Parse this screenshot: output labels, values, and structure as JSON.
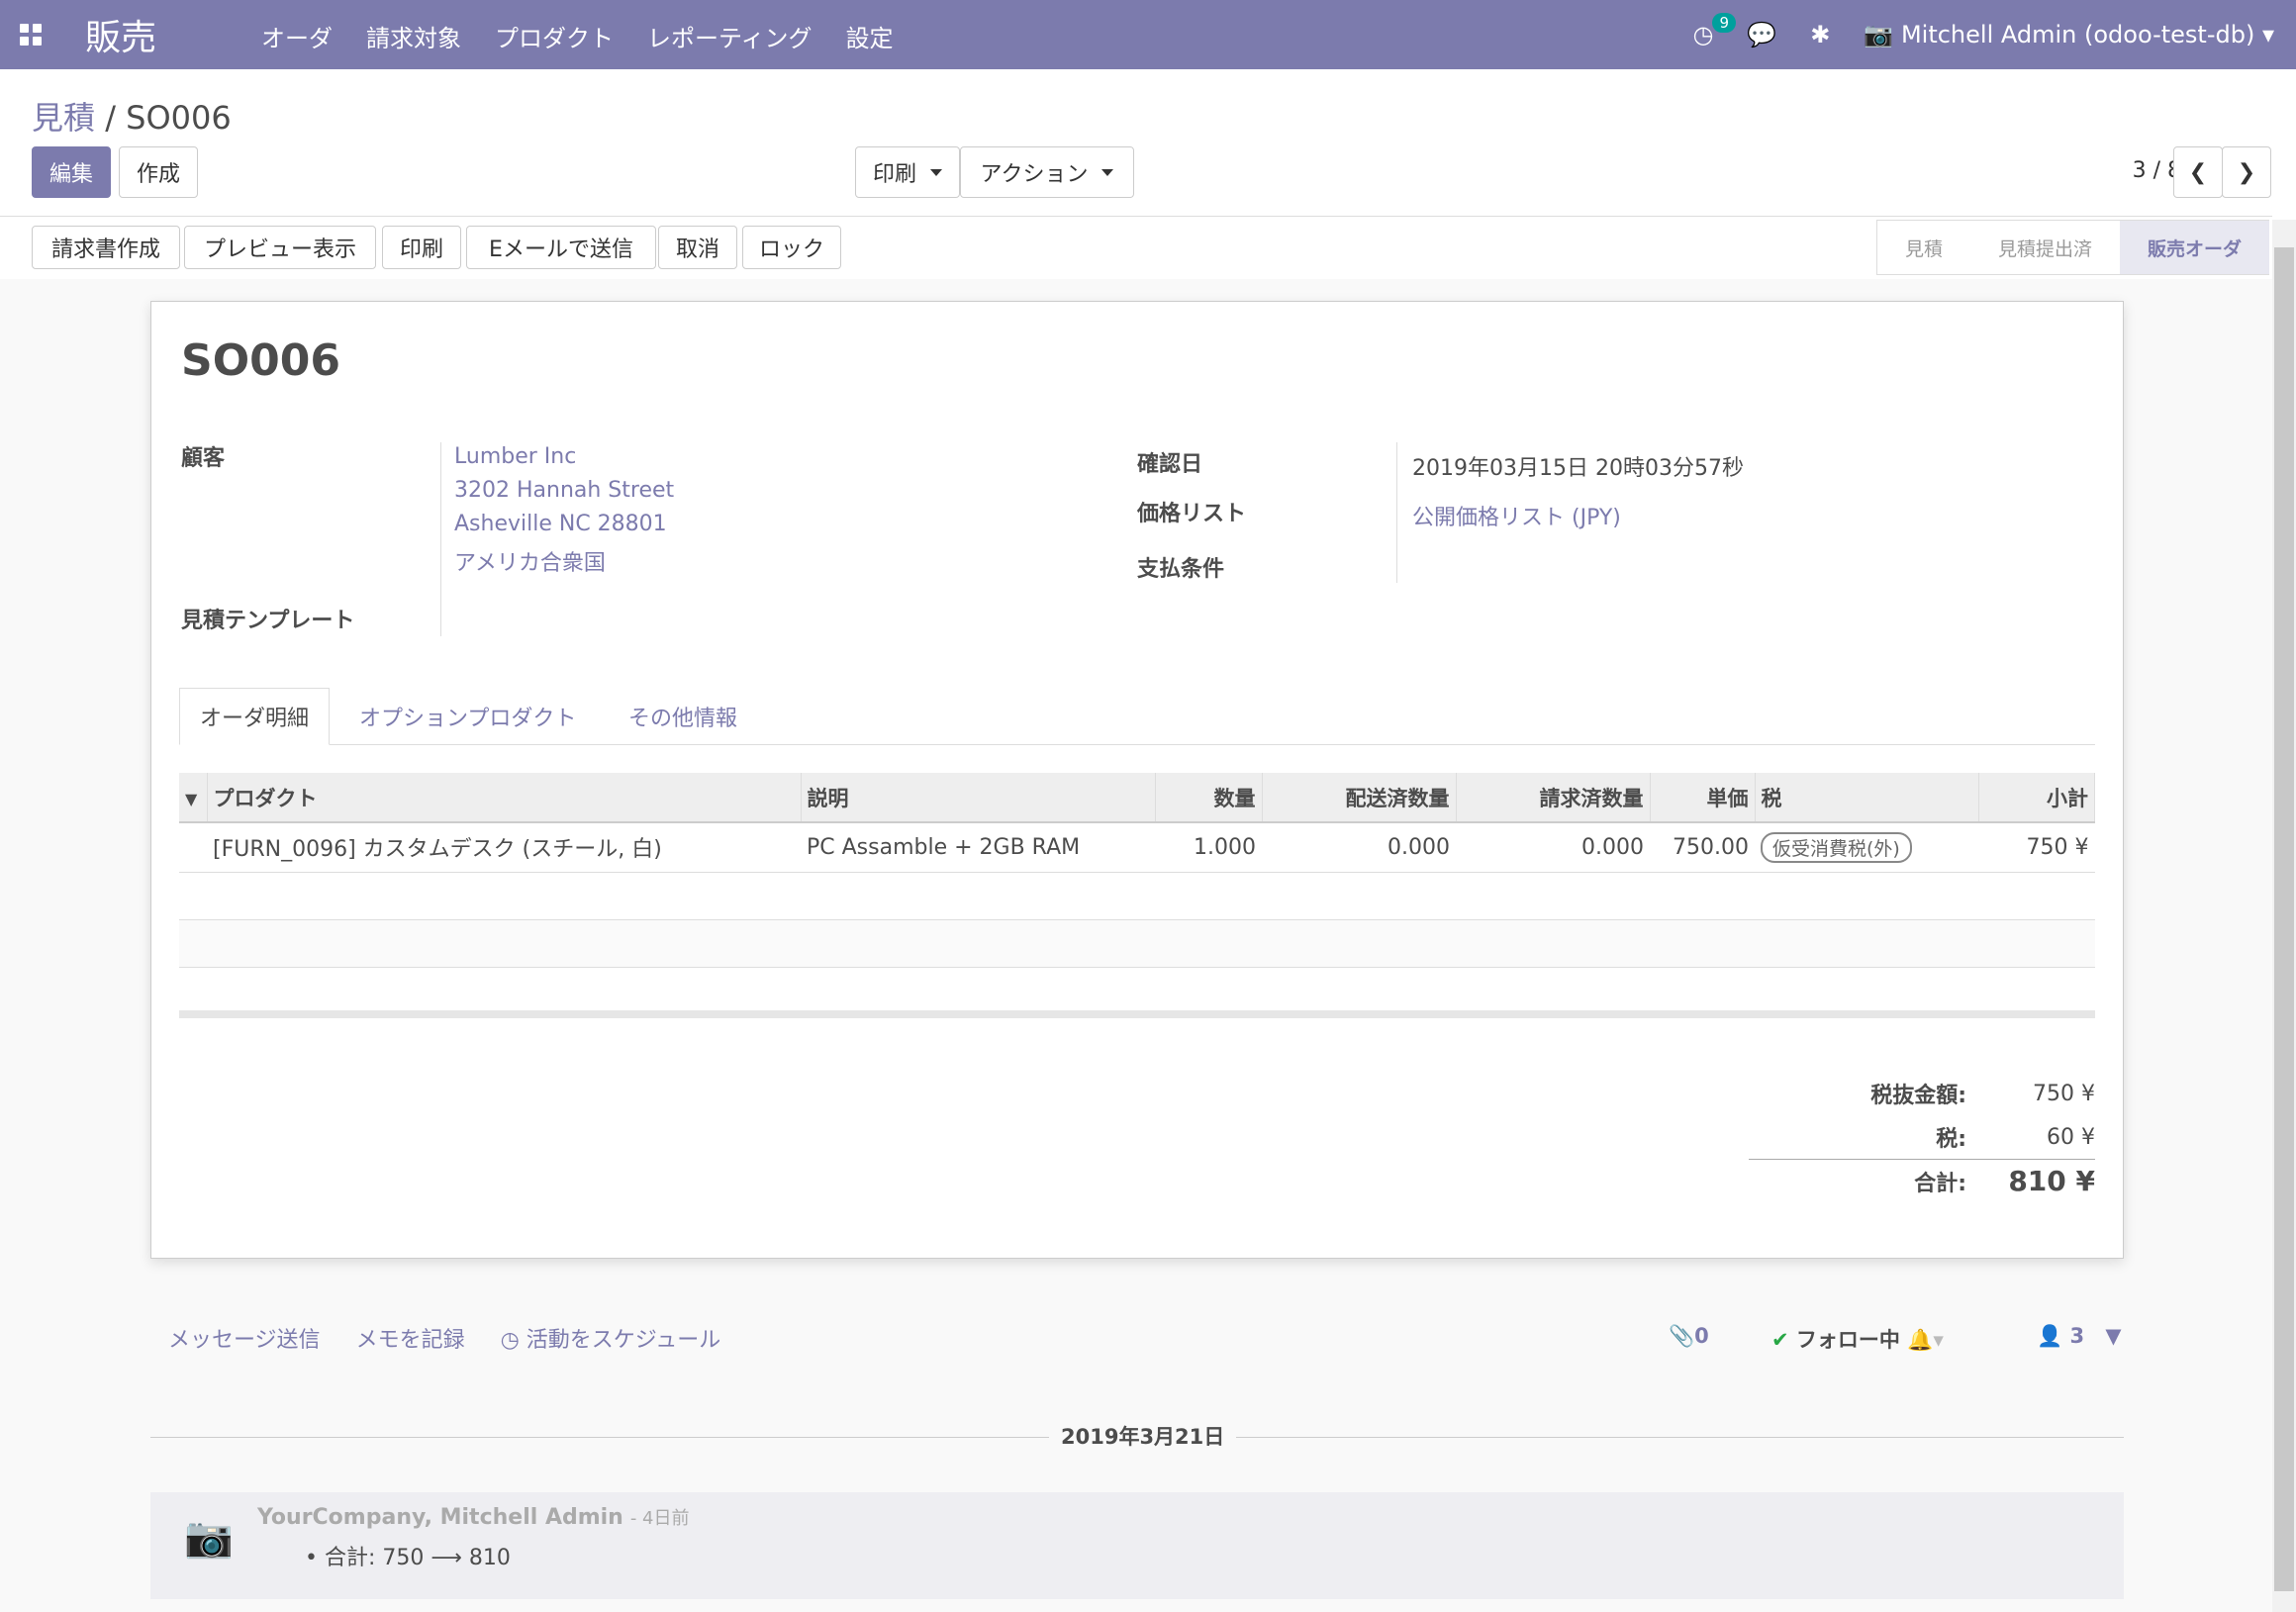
{
  "topbar": {
    "app_name": "販売",
    "menu": [
      "オーダ",
      "請求対象",
      "プロダクト",
      "レポーティング",
      "設定"
    ],
    "activity_count": "9",
    "user": "Mitchell Admin (odoo-test-db)"
  },
  "breadcrumb": {
    "parent": "見積",
    "current": "SO006"
  },
  "control": {
    "edit": "編集",
    "create": "作成",
    "print": "印刷",
    "action": "アクション",
    "pager": "3 / 8"
  },
  "header_buttons": [
    "請求書作成",
    "プレビュー表示",
    "印刷",
    "Eメールで送信",
    "取消",
    "ロック"
  ],
  "stages": [
    "見積",
    "見積提出済",
    "販売オーダ"
  ],
  "form": {
    "name": "SO006",
    "customer_label": "顧客",
    "customer": [
      "Lumber Inc",
      "3202 Hannah Street",
      "Asheville NC 28801",
      "アメリカ合衆国"
    ],
    "template_label": "見積テンプレート",
    "date_label": "確認日",
    "date": "2019年03月15日 20時03分57秒",
    "pricelist_label": "価格リスト",
    "pricelist": "公開価格リスト (JPY)",
    "payment_label": "支払条件"
  },
  "tabs": [
    "オーダ明細",
    "オプションプロダクト",
    "その他情報"
  ],
  "table": {
    "headers": [
      "プロダクト",
      "説明",
      "数量",
      "配送済数量",
      "請求済数量",
      "単価",
      "税",
      "小計"
    ],
    "rows": [
      {
        "product": "[FURN_0096] カスタムデスク (スチール, 白)",
        "desc": "PC Assamble + 2GB RAM",
        "qty": "1.000",
        "delivered": "0.000",
        "invoiced": "0.000",
        "price": "750.00",
        "tax": "仮受消費税(外)",
        "subtotal": "750 ¥"
      }
    ]
  },
  "totals": {
    "untaxed_label": "税抜金額:",
    "untaxed": "750 ¥",
    "tax_label": "税:",
    "tax": "60 ¥",
    "total_label": "合計:",
    "total": "810 ¥"
  },
  "chatter": {
    "send": "メッセージ送信",
    "log": "メモを記録",
    "schedule": "活動をスケジュール",
    "attachments": "0",
    "follow": "フォロー中",
    "followers": "3",
    "date": "2019年3月21日",
    "author": "YourCompany, Mitchell Admin",
    "ago": "- 4日前",
    "change": "合計: 750 ⟶ 810"
  },
  "colors": {
    "brand": "#7c7bad",
    "teal": "#00a09d"
  }
}
